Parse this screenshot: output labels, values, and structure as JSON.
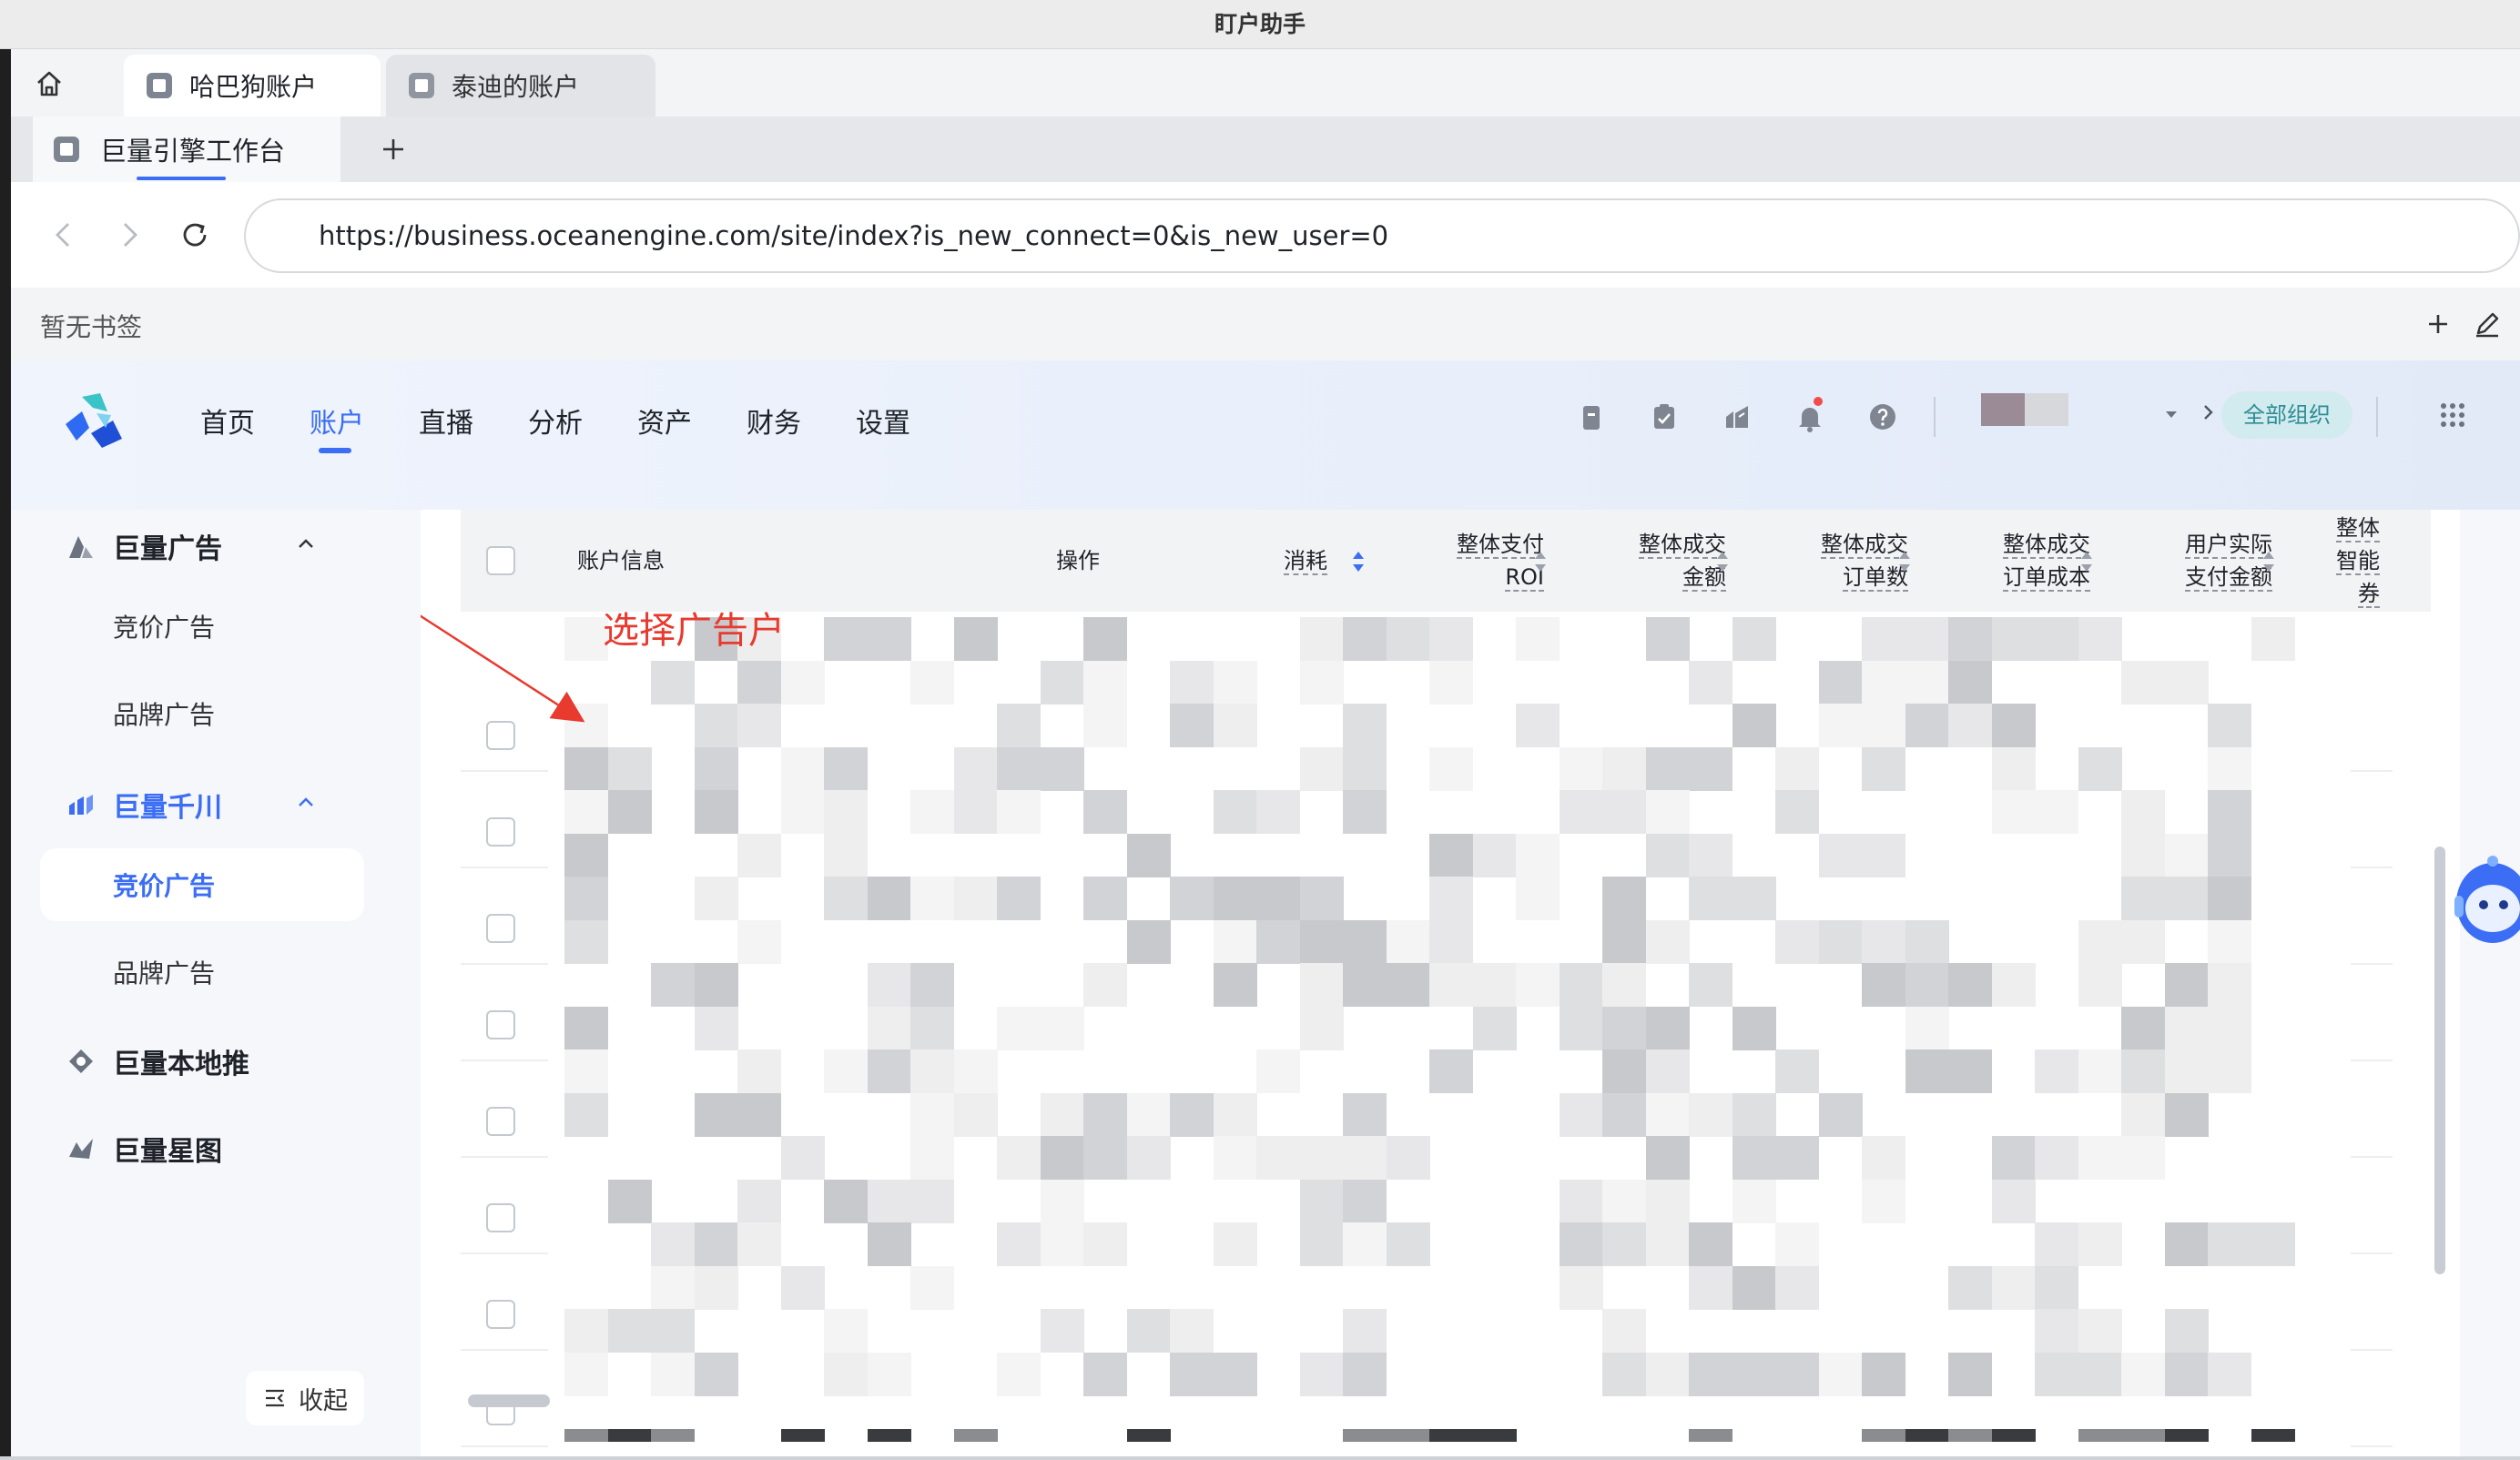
{
  "window": {
    "title": "盯户助手"
  },
  "account_tabs": [
    {
      "label": "哈巴狗账户",
      "active": true
    },
    {
      "label": "泰迪的账户",
      "active": false
    }
  ],
  "browser_tabs": [
    {
      "label": "巨量引擎工作台",
      "active": true
    }
  ],
  "address_bar": {
    "url": "https://business.oceanengine.com/site/index?is_new_connect=0&is_new_user=0"
  },
  "bookmarks": {
    "empty_text": "暂无书签"
  },
  "top_nav": {
    "items": [
      "首页",
      "账户",
      "直播",
      "分析",
      "资产",
      "财务",
      "设置"
    ],
    "active": "账户",
    "org_filter": "全部组织",
    "icons": [
      "clipboard-icon",
      "checklist-icon",
      "share-icon",
      "bell-icon",
      "help-icon",
      "apps-grid-icon"
    ],
    "notification_dot_color": "#f24b4b"
  },
  "sidebar": {
    "groups": [
      {
        "label": "巨量广告",
        "icon": "ad-triangle-icon",
        "expanded": true,
        "items": [
          "竞价广告",
          "品牌广告"
        ]
      },
      {
        "label": "巨量千川",
        "icon": "qianchuan-icon",
        "expanded": true,
        "active": true,
        "items": [
          "竞价广告",
          "品牌广告"
        ],
        "active_item": "竞价广告"
      },
      {
        "label": "巨量本地推",
        "icon": "local-push-icon"
      },
      {
        "label": "巨量星图",
        "icon": "star-map-icon"
      }
    ],
    "collapse_label": "收起"
  },
  "table": {
    "columns": {
      "account_info": "账户信息",
      "actions": "操作",
      "spend": "消耗",
      "pay_roi_1": "整体支付",
      "pay_roi_2": "ROI",
      "gmv_1": "整体成交",
      "gmv_2": "金额",
      "orders_1": "整体成交",
      "orders_2": "订单数",
      "order_cost_1": "整体成交",
      "order_cost_2": "订单成本",
      "actual_pay_1": "用户实际",
      "actual_pay_2": "支付金额",
      "smart_1": "整体",
      "smart_2": "智能",
      "smart_3": "券"
    },
    "row_count": 8,
    "rows_obscured": true
  },
  "annotation": {
    "text": "选择广告户",
    "color": "#e83a2e"
  },
  "colors": {
    "accent": "#3b6df5",
    "org_pill_bg": "#d2ebee",
    "org_pill_text": "#2d8c96"
  }
}
